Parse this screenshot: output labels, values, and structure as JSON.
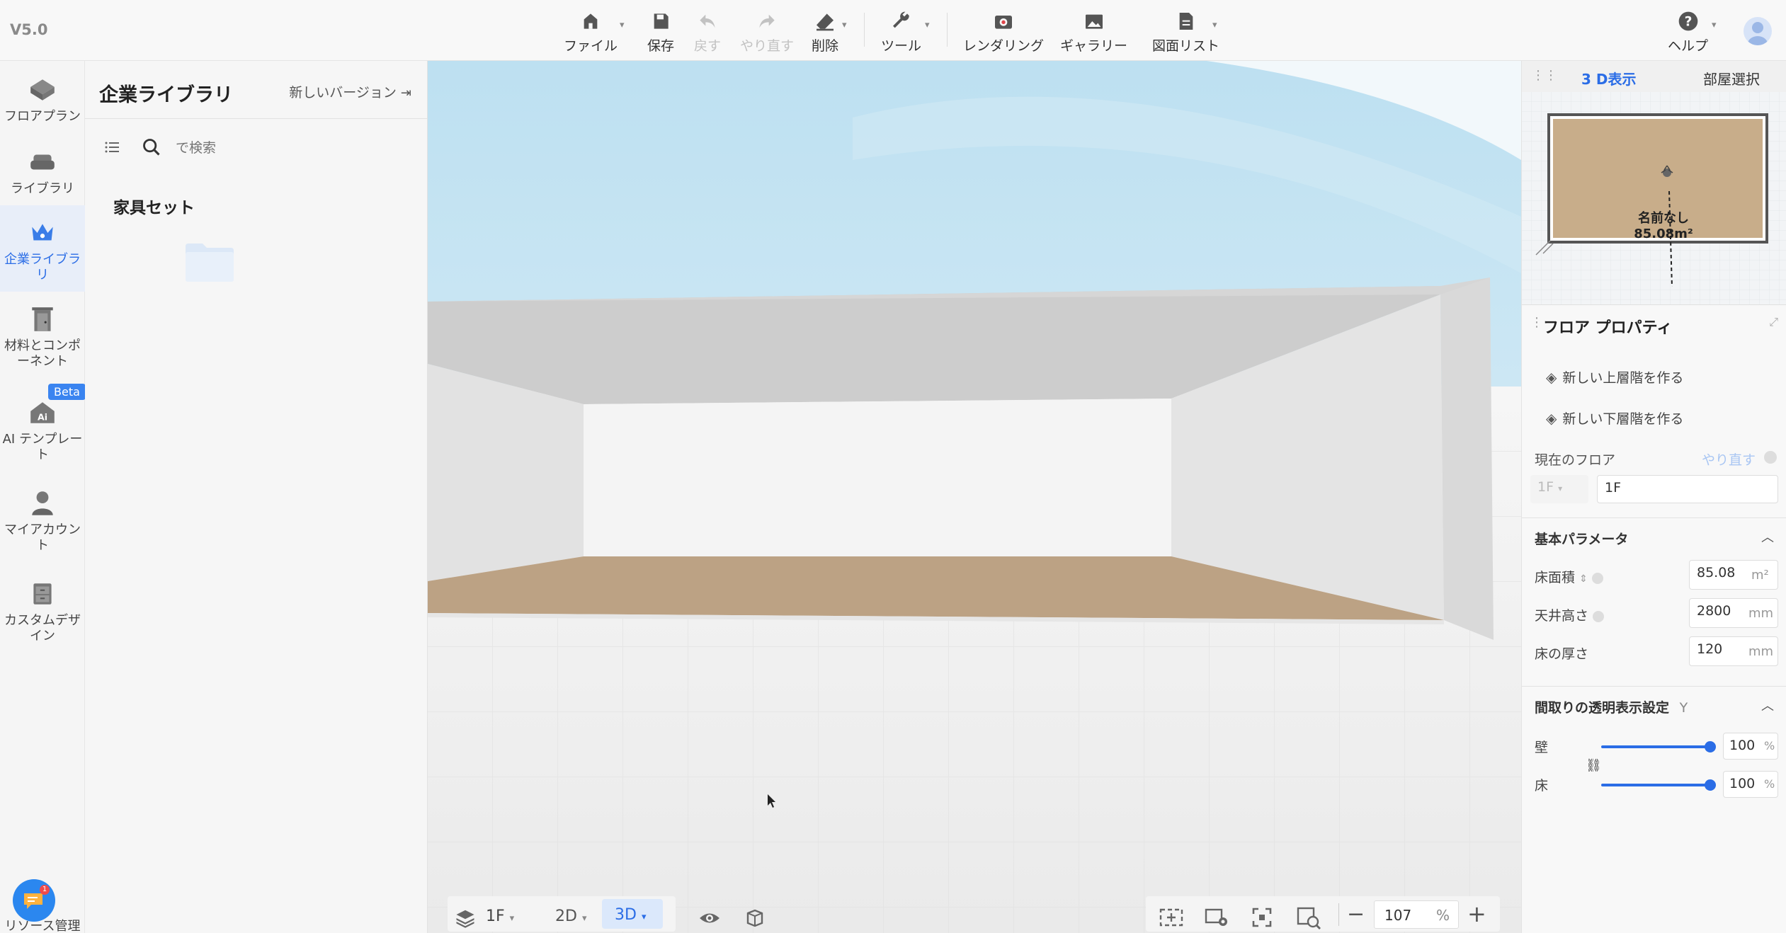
{
  "app": {
    "version": "V5.0"
  },
  "toolbar": {
    "file": "ファイル",
    "save": "保存",
    "undo": "戻す",
    "redo": "やり直す",
    "delete": "削除",
    "tools": "ツール",
    "render": "レンダリング",
    "gallery": "ギャラリー",
    "drawings": "図面リスト",
    "help": "ヘルプ"
  },
  "rail": {
    "floorplan": "フロアプラン",
    "library": "ライブラリ",
    "enterprise": "企業ライブラリ",
    "materials": "材料とコンポーネント",
    "ai_template": "AI テンプレート",
    "beta": "Beta",
    "account": "マイアカウント",
    "custom": "カスタムデザイン",
    "resource": "リソース管理"
  },
  "library": {
    "title": "企業ライブラリ",
    "new_version": "新しいバージョン",
    "search_placeholder": "で検索",
    "section": "家具セット"
  },
  "bottombar": {
    "floor": "1F",
    "mode2d": "2D",
    "mode3d": "3D",
    "zoom": "107",
    "zoom_unit": "%"
  },
  "right": {
    "tab_3d": "3 D表示",
    "tab_room": "部屋選択",
    "room_name": "名前なし",
    "room_area": "85.08m²",
    "props_title": "フロア プロパティ",
    "new_upper": "新しい上層階を作る",
    "new_lower": "新しい下層階を作る",
    "current_floor": "現在のフロア",
    "redo": "やり直す",
    "floor_select": "1F",
    "floor_name": "1F",
    "basic_params": "基本パラメータ",
    "area_label": "床面積",
    "area_value": "85.08",
    "area_unit": "m²",
    "ceiling_label": "天井高さ",
    "ceiling_value": "2800",
    "ceiling_unit": "mm",
    "floor_thick_label": "床の厚さ",
    "floor_thick_value": "120",
    "floor_thick_unit": "mm",
    "transparency": "間取りの透明表示設定",
    "transparency_key": "Y",
    "wall_label": "壁",
    "wall_value": "100",
    "floor_label": "床",
    "floor_value": "100",
    "pct": "%"
  },
  "status": {
    "wall_opacity": 1.0,
    "floor_opacity": 1.0
  }
}
